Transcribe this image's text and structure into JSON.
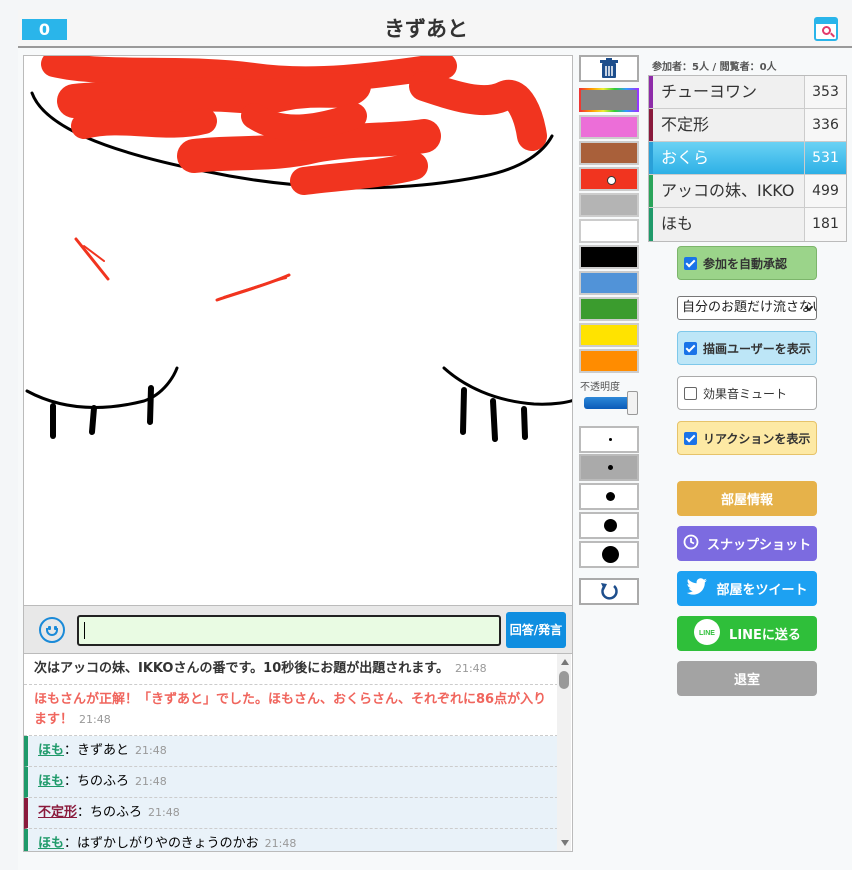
{
  "header": {
    "score": "0",
    "title": "きずあと"
  },
  "palette": {
    "colors": [
      "#848484",
      "#ec6ed8",
      "#a9603a",
      "#f1341f",
      "#b4b4b4",
      "#ffffff",
      "#000000",
      "#5193d8",
      "#3b9c2e",
      "#ffe300",
      "#ff8c00"
    ],
    "selected_color": "#f1341f",
    "opacity_label": "不透明度",
    "opacity": 1.0,
    "brush_sizes": [
      "1",
      "2",
      "3",
      "4",
      "5"
    ],
    "selected_size": "2"
  },
  "players": {
    "header": "参加者：5人 / 閲覧者：0人",
    "list": [
      {
        "name": "チューヨワン",
        "score": "353",
        "color": "#8e2ba8"
      },
      {
        "name": "不定形",
        "score": "336",
        "color": "#8a1a3c"
      },
      {
        "name": "おくら",
        "score": "531",
        "color": "#2aa0d8",
        "active": true
      },
      {
        "name": "アッコの妹、IKKO",
        "score": "499",
        "color": "#2aa45a"
      },
      {
        "name": "ほも",
        "score": "181",
        "color": "#1f9a6a"
      }
    ]
  },
  "options": {
    "auto_approve": "参加を自動承認",
    "select_value": "自分のお題だけ流さない",
    "show_drawer": "描画ユーザーを表示",
    "mute_sfx": "効果音ミュート",
    "show_reactions": "リアクションを表示"
  },
  "actions": {
    "room_info": "部屋情報",
    "snapshot": "スナップショット",
    "tweet": "部屋をツイート",
    "line": "LINEに送る",
    "line_badge": "LINE",
    "leave": "退室"
  },
  "chat": {
    "send_label": "回答/発言",
    "messages": [
      {
        "type": "sys",
        "text": "次はアッコの妹、IKKOさんの番です。10秒後にお題が出題されます。",
        "time": "21:48"
      },
      {
        "type": "correct",
        "text": "ほもさんが正解！「きずあと」でした。ほもさん、おくらさん、それぞれに86点が入ります！",
        "time": "21:48"
      },
      {
        "type": "user",
        "user": "ほも",
        "text": "：きずあと",
        "time": "21:48",
        "color": "#1f9a6a"
      },
      {
        "type": "user",
        "user": "ほも",
        "text": "：ちのふろ",
        "time": "21:48",
        "color": "#1f9a6a"
      },
      {
        "type": "user",
        "user": "不定形",
        "text": "：ちのふろ",
        "time": "21:48",
        "color": "#8a1a3c"
      },
      {
        "type": "user",
        "user": "ほも",
        "text": "：はずかしがりやのきょうのかお",
        "time": "21:48",
        "color": "#1f9a6a"
      }
    ]
  }
}
